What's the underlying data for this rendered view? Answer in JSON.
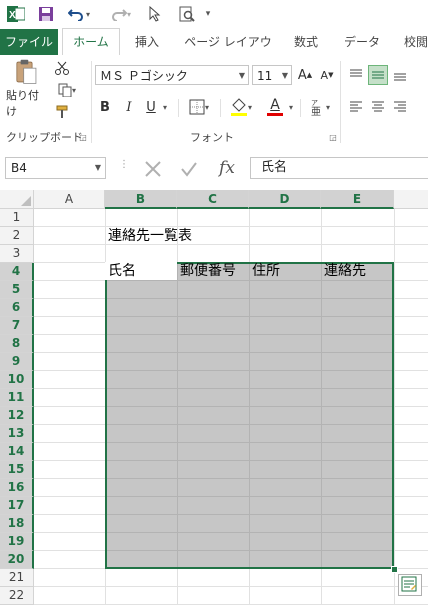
{
  "qat": {
    "customize": "▾"
  },
  "tabs": [
    "ファイル",
    "ホーム",
    "挿入",
    "ページ レイアウト",
    "数式",
    "データ",
    "校閲"
  ],
  "clipboard": {
    "paste_label": "貼り付け",
    "group_label": "クリップボード"
  },
  "font": {
    "name": "ＭＳ Ｐゴシック",
    "size": "11",
    "group_label": "フォント",
    "bold": "B",
    "italic": "I",
    "underline": "U",
    "font_color_letter": "A",
    "font_color": "#e00000"
  },
  "formula_bar": {
    "name_box": "B4",
    "fx": "fx",
    "content": "氏名"
  },
  "columns": [
    "A",
    "B",
    "C",
    "D",
    "E"
  ],
  "rows": [
    "1",
    "2",
    "3",
    "4",
    "5",
    "6",
    "7",
    "8",
    "9",
    "10",
    "11",
    "12",
    "13",
    "14",
    "15",
    "16",
    "17",
    "18",
    "19",
    "20",
    "21",
    "22"
  ],
  "cells": {
    "B2": "連絡先一覧表",
    "B4": "氏名",
    "C4": "郵便番号",
    "D4": "住所",
    "E4": "連絡先"
  },
  "accent": "#217346"
}
